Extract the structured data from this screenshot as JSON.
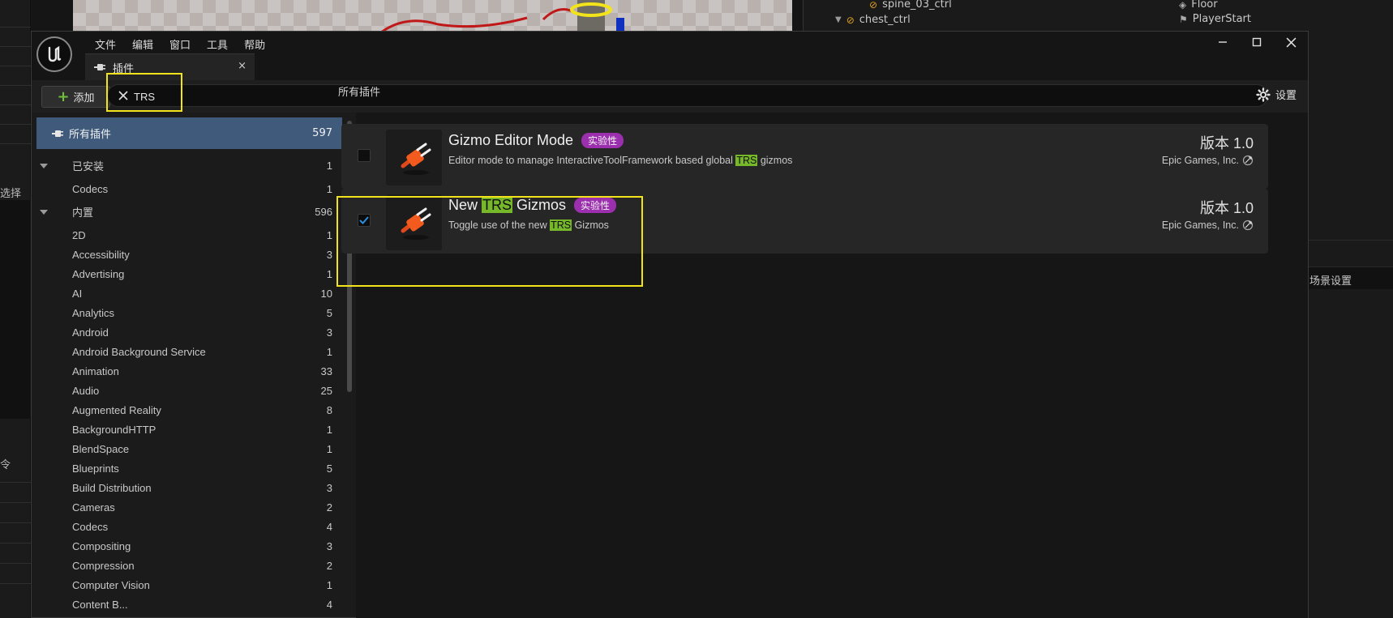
{
  "background": {
    "outliner": {
      "items": [
        "spine_03_ctrl",
        "chest_ctrl"
      ]
    },
    "world_outliner": {
      "items": [
        "Floor",
        "PlayerStart"
      ]
    },
    "side_panel_label": "场景设置",
    "left_cut_text": [
      "选择",
      "令"
    ]
  },
  "dialog": {
    "menu": [
      "文件",
      "编辑",
      "窗口",
      "工具",
      "帮助"
    ],
    "tab": {
      "label": "插件",
      "close": "×"
    },
    "toolbar": {
      "add_label": "添加",
      "search_value": "TRS",
      "settings_label": "设置"
    },
    "section_title": "所有插件",
    "categories": {
      "all": {
        "label": "所有插件",
        "count": "597"
      },
      "rows": [
        {
          "label": "已安装",
          "count": "1",
          "group": true
        },
        {
          "label": "Codecs",
          "count": "1"
        },
        {
          "label": "内置",
          "count": "596",
          "group": true
        },
        {
          "label": "2D",
          "count": "1"
        },
        {
          "label": "Accessibility",
          "count": "3"
        },
        {
          "label": "Advertising",
          "count": "1"
        },
        {
          "label": "AI",
          "count": "10"
        },
        {
          "label": "Analytics",
          "count": "5"
        },
        {
          "label": "Android",
          "count": "3"
        },
        {
          "label": "Android Background Service",
          "count": "1"
        },
        {
          "label": "Animation",
          "count": "33"
        },
        {
          "label": "Audio",
          "count": "25"
        },
        {
          "label": "Augmented Reality",
          "count": "8"
        },
        {
          "label": "BackgroundHTTP",
          "count": "1"
        },
        {
          "label": "BlendSpace",
          "count": "1"
        },
        {
          "label": "Blueprints",
          "count": "5"
        },
        {
          "label": "Build Distribution",
          "count": "3"
        },
        {
          "label": "Cameras",
          "count": "2"
        },
        {
          "label": "Codecs",
          "count": "4"
        },
        {
          "label": "Compositing",
          "count": "3"
        },
        {
          "label": "Compression",
          "count": "2"
        },
        {
          "label": "Computer Vision",
          "count": "1"
        },
        {
          "label": "Content B...",
          "count": "4"
        }
      ]
    },
    "plugins": [
      {
        "name_parts": [
          "Gizmo Editor Mode"
        ],
        "badge": "实验性",
        "desc_parts": [
          "Editor mode to manage InteractiveToolFramework based global ",
          "TRS",
          " gizmos"
        ],
        "version": "版本 1.0",
        "vendor": "Epic Games, Inc.",
        "enabled": false
      },
      {
        "name_parts": [
          "New ",
          "TRS",
          " Gizmos"
        ],
        "badge": "实验性",
        "desc_parts": [
          "Toggle use of the new ",
          "TRS",
          " Gizmos"
        ],
        "version": "版本 1.0",
        "vendor": "Epic Games, Inc.",
        "enabled": true
      }
    ]
  },
  "colors": {
    "accent_selected": "#3f5a7b",
    "highlight_match": "#76b82a",
    "badge": "#9b2fae",
    "annotation": "#f2e31b",
    "add_plus": "#6ec03a"
  }
}
